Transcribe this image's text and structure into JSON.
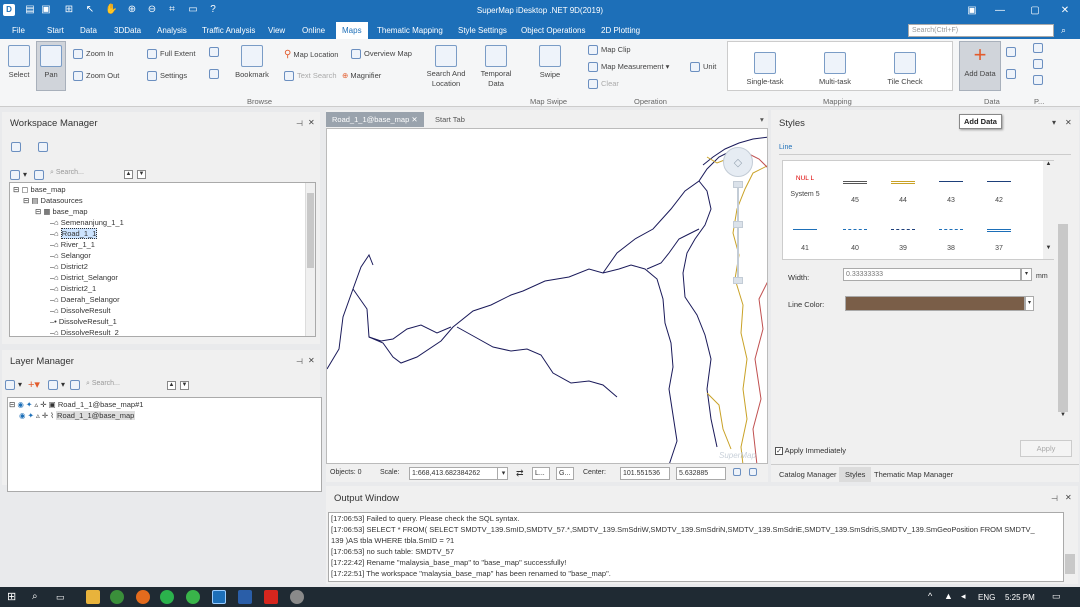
{
  "app": {
    "title": "SuperMap iDesktop .NET 9D(2019)"
  },
  "menu": {
    "tabs": [
      "File",
      "Start",
      "Data",
      "3DData",
      "Analysis",
      "Traffic Analysis",
      "View",
      "Online",
      "Maps",
      "Thematic Mapping",
      "Style Settings",
      "Object Operations",
      "2D Plotting"
    ],
    "search_placeholder": "Search(Ctrl+F)"
  },
  "ribbon": {
    "select": "Select",
    "pan": "Pan",
    "zoom_in": "Zoom In",
    "zoom_out": "Zoom Out",
    "full_extent": "Full Extent",
    "settings": "Settings",
    "bookmark": "Bookmark",
    "map_location": "Map Location",
    "overview_map": "Overview Map",
    "text_search": "Text Search",
    "magnifier": "Magnifier",
    "search_location": "Search And Location",
    "temporal_data": "Temporal Data",
    "swipe": "Swipe",
    "map_clip": "Map Clip",
    "map_measurement": "Map Measurement",
    "unit": "Unit",
    "clear": "Clear",
    "single_task": "Single-task",
    "multi_task": "Multi-task",
    "tile_check": "Tile Check",
    "add_data": "Add Data",
    "groups": {
      "browse": "Browse",
      "map_swipe": "Map Swipe",
      "operation": "Operation",
      "mapping": "Mapping",
      "data": "Data",
      "p": "P..."
    },
    "tooltip": "Add Data"
  },
  "workspace": {
    "title": "Workspace Manager",
    "search_placeholder": "Search...",
    "tree": [
      "base_map",
      "Datasources",
      "base_map",
      "Semenanjung_1_1",
      "Road_1_1",
      "River_1_1",
      "Selangor",
      "District2",
      "District_Selangor",
      "District2_1",
      "Daerah_Selangor",
      "DissolveResult",
      "DissolveResult_1",
      "DissolveResult_2"
    ]
  },
  "layers": {
    "title": "Layer Manager",
    "search_placeholder": "Search...",
    "items": [
      "Road_1_1@base_map#1",
      "Road_1_1@base_map"
    ]
  },
  "map": {
    "tabs": [
      "Road_1_1@base_map",
      "Start Tab"
    ],
    "watermark": "SuperMap",
    "status": {
      "objects": "Objects: 0",
      "scale_label": "Scale:",
      "scale": "1:668,413.682384262",
      "l": "L...",
      "g": "G...",
      "center_label": "Center:",
      "cx": "101.551536",
      "cy": "5.632885"
    }
  },
  "styles": {
    "title": "Styles",
    "section": "Line",
    "nul_label": "NUL L",
    "cells": [
      "System 5",
      "45",
      "44",
      "43",
      "42",
      "41",
      "40",
      "39",
      "38",
      "37"
    ],
    "width_label": "Width:",
    "width_value": "0.33333333",
    "width_unit": "mm",
    "color_label": "Line Color:",
    "line_color": "#7a5e48",
    "apply_immediately": "Apply Immediately",
    "apply": "Apply",
    "bottom_tabs": [
      "Catalog Manager",
      "Styles",
      "Thematic Map Manager"
    ]
  },
  "output": {
    "title": "Output Window",
    "lines": [
      "[17:06:53] Failed to query. Please check the SQL syntax.",
      "[17:06:53] SELECT * FROM( SELECT SMDTV_139.SmID,SMDTV_57.*,SMDTV_139.SmSdriW,SMDTV_139.SmSdriN,SMDTV_139.SmSdriE,SMDTV_139.SmSdriS,SMDTV_139.SmGeoPosition  FROM SMDTV_",
      "139 )AS tbla WHERE tbla.SmID = ?1",
      "[17:06:53] no such table: SMDTV_57",
      "[17:22:42] Rename \"malaysia_base_map\" to \"base_map\" successfully!",
      "[17:22:51] The workspace \"malaysia_base_map\" has been renamed to \"base_map\"."
    ]
  },
  "taskbar": {
    "lang": "ENG",
    "time": "5:25 PM"
  },
  "colors": {
    "titlebar": "#1d6fb8",
    "road": "#1a1a5a",
    "accent": "#e25b2c"
  }
}
